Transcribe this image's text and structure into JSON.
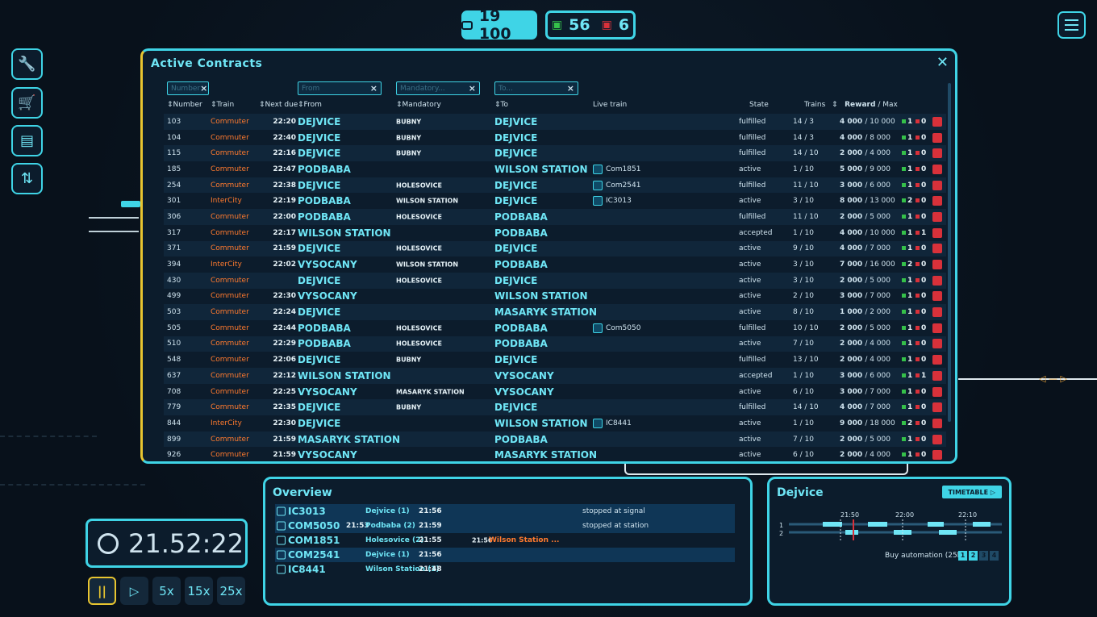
{
  "topbar": {
    "money": "19 100",
    "trains_green": "56",
    "trains_red": "6"
  },
  "sidebar": [
    {
      "icon": "wrench-icon"
    },
    {
      "icon": "cart-icon"
    },
    {
      "icon": "book-icon"
    },
    {
      "icon": "settings-sliders-icon"
    }
  ],
  "contracts": {
    "title": "Active Contracts",
    "filters": {
      "number": "Number",
      "from": "From",
      "mandatory": "Mandatory...",
      "to": "To..."
    },
    "headers": {
      "number": "Number",
      "train": "Train",
      "next_due": "Next due",
      "from": "From",
      "mandatory": "Mandatory",
      "to": "To",
      "live_train": "Live train",
      "state": "State",
      "trains": "Trains",
      "reward": "Reward",
      "max": "/ Max"
    },
    "rows": [
      {
        "num": "103",
        "train": "Commuter",
        "due": "22:20",
        "from": "DEJVICE",
        "mand": "BUBNY",
        "to": "DEJVICE",
        "live": "",
        "state": "fulfilled",
        "trains": "14 / 3",
        "reward": "4 000",
        "max": "/ 10 000",
        "g": "1",
        "r": "0"
      },
      {
        "num": "104",
        "train": "Commuter",
        "due": "22:40",
        "from": "DEJVICE",
        "mand": "BUBNY",
        "to": "DEJVICE",
        "live": "",
        "state": "fulfilled",
        "trains": "14 / 3",
        "reward": "4 000",
        "max": "/ 8 000",
        "g": "1",
        "r": "0"
      },
      {
        "num": "115",
        "train": "Commuter",
        "due": "22:16",
        "from": "DEJVICE",
        "mand": "BUBNY",
        "to": "DEJVICE",
        "live": "",
        "state": "fulfilled",
        "trains": "14 / 10",
        "reward": "2 000",
        "max": "/ 4 000",
        "g": "1",
        "r": "0"
      },
      {
        "num": "185",
        "train": "Commuter",
        "due": "22:47",
        "from": "PODBABA",
        "mand": "",
        "to": "WILSON STATION",
        "live": "Com1851",
        "state": "active",
        "trains": "1 / 10",
        "reward": "5 000",
        "max": "/ 9 000",
        "g": "1",
        "r": "0"
      },
      {
        "num": "254",
        "train": "Commuter",
        "due": "22:38",
        "from": "DEJVICE",
        "mand": "HOLESOVICE",
        "to": "DEJVICE",
        "live": "Com2541",
        "state": "fulfilled",
        "trains": "11 / 10",
        "reward": "3 000",
        "max": "/ 6 000",
        "g": "1",
        "r": "0"
      },
      {
        "num": "301",
        "train": "InterCity",
        "due": "22:19",
        "from": "PODBABA",
        "mand": "WILSON STATION",
        "to": "DEJVICE",
        "live": "IC3013",
        "state": "active",
        "trains": "3 / 10",
        "reward": "8 000",
        "max": "/ 13 000",
        "g": "2",
        "r": "0"
      },
      {
        "num": "306",
        "train": "Commuter",
        "due": "22:00",
        "from": "PODBABA",
        "mand": "HOLESOVICE",
        "to": "PODBABA",
        "live": "",
        "state": "fulfilled",
        "trains": "11 / 10",
        "reward": "2 000",
        "max": "/ 5 000",
        "g": "1",
        "r": "0"
      },
      {
        "num": "317",
        "train": "Commuter",
        "due": "22:17",
        "from": "WILSON STATION",
        "mand": "",
        "to": "PODBABA",
        "live": "",
        "state": "accepted",
        "trains": "1 / 10",
        "reward": "4 000",
        "max": "/ 10 000",
        "g": "1",
        "r": "1"
      },
      {
        "num": "371",
        "train": "Commuter",
        "due": "21:59",
        "from": "DEJVICE",
        "mand": "HOLESOVICE",
        "to": "DEJVICE",
        "live": "",
        "state": "active",
        "trains": "9 / 10",
        "reward": "4 000",
        "max": "/ 7 000",
        "g": "1",
        "r": "0"
      },
      {
        "num": "394",
        "train": "InterCity",
        "due": "22:02",
        "from": "VYSOCANY",
        "mand": "WILSON STATION",
        "to": "PODBABA",
        "live": "",
        "state": "active",
        "trains": "3 / 10",
        "reward": "7 000",
        "max": "/ 16 000",
        "g": "2",
        "r": "0"
      },
      {
        "num": "430",
        "train": "Commuter",
        "due": "",
        "from": "DEJVICE",
        "mand": "HOLESOVICE",
        "to": "DEJVICE",
        "live": "",
        "state": "active",
        "trains": "3 / 10",
        "reward": "2 000",
        "max": "/ 5 000",
        "g": "1",
        "r": "0"
      },
      {
        "num": "499",
        "train": "Commuter",
        "due": "22:30",
        "from": "VYSOCANY",
        "mand": "",
        "to": "WILSON STATION",
        "live": "",
        "state": "active",
        "trains": "2 / 10",
        "reward": "3 000",
        "max": "/ 7 000",
        "g": "1",
        "r": "0"
      },
      {
        "num": "503",
        "train": "Commuter",
        "due": "22:24",
        "from": "DEJVICE",
        "mand": "",
        "to": "MASARYK STATION",
        "live": "",
        "state": "active",
        "trains": "8 / 10",
        "reward": "1 000",
        "max": "/ 2 000",
        "g": "1",
        "r": "0"
      },
      {
        "num": "505",
        "train": "Commuter",
        "due": "22:44",
        "from": "PODBABA",
        "mand": "HOLESOVICE",
        "to": "PODBABA",
        "live": "Com5050",
        "state": "fulfilled",
        "trains": "10 / 10",
        "reward": "2 000",
        "max": "/ 5 000",
        "g": "1",
        "r": "0"
      },
      {
        "num": "510",
        "train": "Commuter",
        "due": "22:29",
        "from": "PODBABA",
        "mand": "HOLESOVICE",
        "to": "PODBABA",
        "live": "",
        "state": "active",
        "trains": "7 / 10",
        "reward": "2 000",
        "max": "/ 4 000",
        "g": "1",
        "r": "0"
      },
      {
        "num": "548",
        "train": "Commuter",
        "due": "22:06",
        "from": "DEJVICE",
        "mand": "BUBNY",
        "to": "DEJVICE",
        "live": "",
        "state": "fulfilled",
        "trains": "13 / 10",
        "reward": "2 000",
        "max": "/ 4 000",
        "g": "1",
        "r": "0"
      },
      {
        "num": "637",
        "train": "Commuter",
        "due": "22:12",
        "from": "WILSON STATION",
        "mand": "",
        "to": "VYSOCANY",
        "live": "",
        "state": "accepted",
        "trains": "1 / 10",
        "reward": "3 000",
        "max": "/ 6 000",
        "g": "1",
        "r": "1"
      },
      {
        "num": "708",
        "train": "Commuter",
        "due": "22:25",
        "from": "VYSOCANY",
        "mand": "MASARYK STATION",
        "to": "VYSOCANY",
        "live": "",
        "state": "active",
        "trains": "6 / 10",
        "reward": "3 000",
        "max": "/ 7 000",
        "g": "1",
        "r": "0"
      },
      {
        "num": "779",
        "train": "Commuter",
        "due": "22:35",
        "from": "DEJVICE",
        "mand": "BUBNY",
        "to": "DEJVICE",
        "live": "",
        "state": "fulfilled",
        "trains": "14 / 10",
        "reward": "4 000",
        "max": "/ 7 000",
        "g": "1",
        "r": "0"
      },
      {
        "num": "844",
        "train": "InterCity",
        "due": "22:30",
        "from": "DEJVICE",
        "mand": "",
        "to": "WILSON STATION",
        "live": "IC8441",
        "state": "active",
        "trains": "1 / 10",
        "reward": "9 000",
        "max": "/ 18 000",
        "g": "2",
        "r": "0"
      },
      {
        "num": "899",
        "train": "Commuter",
        "due": "21:59",
        "from": "MASARYK STATION",
        "mand": "",
        "to": "PODBABA",
        "live": "",
        "state": "active",
        "trains": "7 / 10",
        "reward": "2 000",
        "max": "/ 5 000",
        "g": "1",
        "r": "0"
      },
      {
        "num": "926",
        "train": "Commuter",
        "due": "21:59",
        "from": "VYSOCANY",
        "mand": "",
        "to": "MASARYK STATION",
        "live": "",
        "state": "active",
        "trains": "6 / 10",
        "reward": "2 000",
        "max": "/ 4 000",
        "g": "1",
        "r": "0"
      }
    ]
  },
  "overview": {
    "title": "Overview",
    "rows": [
      {
        "name": "IC3013",
        "t1": "",
        "s1": "Dejvice (1)",
        "t2": "21:56",
        "t3": "",
        "s3": "",
        "status": "stopped at signal",
        "highlight": true
      },
      {
        "name": "COM5050",
        "t1": "21:53",
        "s1": "Podbaba (2)",
        "t2": "21:59",
        "t3": "",
        "s3": "",
        "status": "stopped at station",
        "highlight": true
      },
      {
        "name": "COM1851",
        "t1": "",
        "s1": "Holesovice (2)",
        "t2": "21:55",
        "t3": "21:56",
        "s3": "Wilson Station ...",
        "status": "",
        "highlight": false
      },
      {
        "name": "COM2541",
        "t1": "",
        "s1": "Dejvice (1)",
        "t2": "21:56",
        "t3": "",
        "s3": "",
        "status": "",
        "highlight": true
      },
      {
        "name": "IC8441",
        "t1": "",
        "s1": "Wilson Station (1)",
        "t2": "21:48",
        "t3": "",
        "s3": "",
        "status": "",
        "highlight": false
      }
    ]
  },
  "station": {
    "title": "Dejvice",
    "timetable_button": "TIMETABLE ▷",
    "times": [
      "21:50",
      "22:00",
      "22:10"
    ],
    "tracks": [
      "1",
      "2"
    ],
    "automation": "Buy automation (25k)",
    "pages": [
      "1",
      "2",
      "3",
      "4"
    ]
  },
  "clock": {
    "time": "21.52:22"
  },
  "speed": {
    "pause": "||",
    "play": "▷",
    "s5": "5x",
    "s15": "15x",
    "s25": "25x"
  },
  "colors": {
    "accent": "#3fd4e6",
    "train_orange": "#ff7a2e",
    "clock_border": "#e8c530"
  }
}
